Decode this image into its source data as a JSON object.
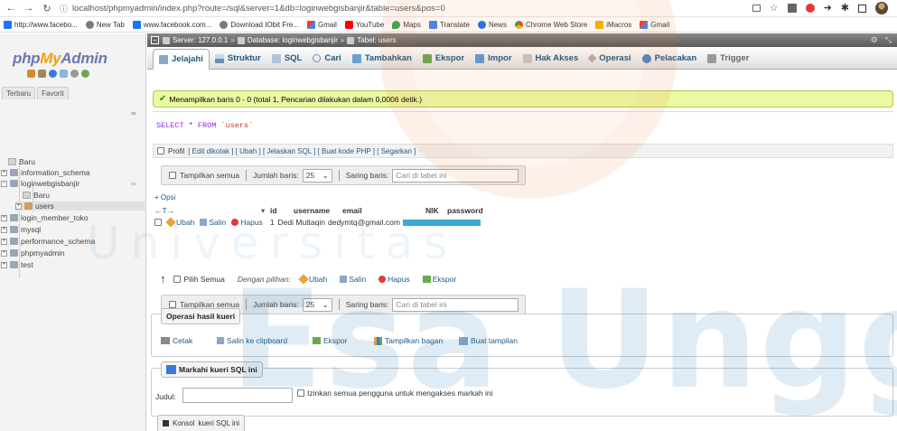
{
  "browser": {
    "url": "localhost/phpmyadmin/index.php?route=/sql&server=1&db=loginwebgisbanjir&table=users&pos=0",
    "bookmarks": [
      {
        "icon": "facebook-icon",
        "label": "http://www.facebo..."
      },
      {
        "icon": "globe-icon",
        "label": "New Tab"
      },
      {
        "icon": "facebook-icon",
        "label": "www.facebook.com..."
      },
      {
        "icon": "globe-icon",
        "label": "Download IObit Fre..."
      },
      {
        "icon": "gmail-icon",
        "label": "Gmail"
      },
      {
        "icon": "youtube-icon",
        "label": "YouTube"
      },
      {
        "icon": "maps-icon",
        "label": "Maps"
      },
      {
        "icon": "translate-icon",
        "label": "Translate"
      },
      {
        "icon": "news-icon",
        "label": "News"
      },
      {
        "icon": "chrome-web-store-icon",
        "label": "Chrome Web Store"
      },
      {
        "icon": "imacros-icon",
        "label": "iMacros"
      },
      {
        "icon": "gmail-icon",
        "label": "Gmail"
      }
    ]
  },
  "sidebar": {
    "logo": {
      "php": "php",
      "my": "My",
      "admin": "Admin"
    },
    "tabs": [
      "Terbaru",
      "Favorit"
    ],
    "tree": {
      "new_root": "Baru",
      "databases": [
        "information_schema",
        "loginwebgisbanjir"
      ],
      "sub_new": "Baru",
      "table": "users",
      "more_dbs": [
        "login_member_toko",
        "mysql",
        "performance_schema",
        "phpmyadmin",
        "test"
      ]
    }
  },
  "breadcrumb": {
    "server": "Server: 127.0.0.1",
    "database": "Database: loginwebgisbanjir",
    "table": "Tabel: users"
  },
  "tabs": [
    {
      "label": "Jelajahi",
      "icon": "browse-icon",
      "active": true
    },
    {
      "label": "Struktur",
      "icon": "structure-icon"
    },
    {
      "label": "SQL",
      "icon": "sql-icon"
    },
    {
      "label": "Cari",
      "icon": "search-icon"
    },
    {
      "label": "Tambahkan",
      "icon": "insert-icon"
    },
    {
      "label": "Ekspor",
      "icon": "export-icon"
    },
    {
      "label": "Impor",
      "icon": "import-icon"
    },
    {
      "label": "Hak Akses",
      "icon": "privileges-icon"
    },
    {
      "label": "Operasi",
      "icon": "operations-icon"
    },
    {
      "label": "Pelacakan",
      "icon": "tracking-icon"
    },
    {
      "label": "Trigger",
      "icon": "trigger-icon"
    }
  ],
  "message": "Menampilkan baris 0 - 0 (total 1, Pencarian dilakukan dalam 0,0006 detik.)",
  "sql": {
    "kw1": "SELECT",
    "star": " * ",
    "kw2": "FROM",
    "table": "`users`"
  },
  "sql_links": {
    "profil": "Profil",
    "links": "[ Edit dikotak ] [ Ubah ] [ Jelaskan SQL ] [ Buat kode PHP ] [ Segarkan ]"
  },
  "nav": {
    "show_all": "Tampilkan semua",
    "rows_label": "Jumlah baris:",
    "rows_value": "25",
    "filter_label": "Saring baris:",
    "filter_placeholder": "Cari di tabel ini"
  },
  "results": {
    "opsi": "+ Opsi",
    "columns": [
      "id",
      "username",
      "email",
      "NIK",
      "password"
    ],
    "row": {
      "edit": "Ubah",
      "copy": "Salin",
      "delete": "Hapus",
      "id": "1",
      "username": "Dedi Muttaqin",
      "email": "dedymtq@gmail.com"
    }
  },
  "bulk": {
    "check_all": "Pilih Semua",
    "with_selected": "Dengan pilihan:",
    "edit": "Ubah",
    "copy": "Salin",
    "delete": "Hapus",
    "export": "Ekspor"
  },
  "query_ops": {
    "legend": "Operasi hasil kueri",
    "print": "Cetak",
    "copy_clipboard": "Salin ke clipboard",
    "export": "Ekspor",
    "chart": "Tampilkan bagan",
    "create_view": "Buat tampilan"
  },
  "bookmark_sql": {
    "legend": "Markahi kueri SQL ini",
    "label": "Judul:",
    "allow_all": "Izinkan semua pengguna untuk mengakses markah ini"
  },
  "console": {
    "label": "Konsol",
    "tab": "kueri SQL ini"
  },
  "watermark": {
    "text": "Esa Unggul",
    "small": "Universitas"
  }
}
